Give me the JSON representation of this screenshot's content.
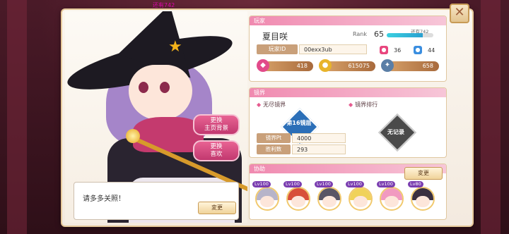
{
  "background": {
    "top_note": "还有742"
  },
  "close_button": {
    "icon": "close-icon",
    "glyph": "✕"
  },
  "portrait": {
    "buttons": [
      {
        "line1": "更换",
        "line2": "主页背景"
      },
      {
        "line1": "更换",
        "line2": "喜欢"
      }
    ]
  },
  "speech": {
    "text": "请多多关照！",
    "change_label": "変更"
  },
  "player_panel": {
    "header": "玩家",
    "name": "夏目咲",
    "rank_label": "Rank",
    "rank_value": "65",
    "xp_note": "还有742",
    "xp_fraction": 0.78,
    "id_label": "玩家ID",
    "id_value": "00exx3ub",
    "counts": [
      {
        "icon": "pink-face-icon",
        "value": "36",
        "color": "#e8467e"
      },
      {
        "icon": "blue-face-icon",
        "value": "44",
        "color": "#3a8ee0"
      }
    ],
    "resources": [
      {
        "icon": "gem-icon",
        "value": "418",
        "color": "#e24a8a"
      },
      {
        "icon": "coin-icon",
        "value": "615075",
        "color": "#e8b42a"
      },
      {
        "icon": "gear-item-icon",
        "value": "658",
        "color": "#5a7ea6"
      }
    ]
  },
  "mirror_panel": {
    "header": "镜界",
    "infinite_label": "无尽镜界",
    "ranking_label": "镜界排行",
    "floor_badge": "第16镜层",
    "stats": [
      {
        "label": "镜界Pt",
        "value": "4000"
      },
      {
        "label": "胜利数",
        "value": "293"
      }
    ],
    "no_record": "无记录"
  },
  "support_panel": {
    "header": "协助",
    "change_label": "変更",
    "members": [
      {
        "lv": "Lv100",
        "hair": "#b7b4c9"
      },
      {
        "lv": "Lv100",
        "hair": "#d8503a"
      },
      {
        "lv": "Lv100",
        "hair": "#5a5565"
      },
      {
        "lv": "Lv100",
        "hair": "#f0d25a"
      },
      {
        "lv": "Lv100",
        "hair": "#f19ac0"
      },
      {
        "lv": "Lv80",
        "hair": "#3a3040"
      }
    ]
  }
}
